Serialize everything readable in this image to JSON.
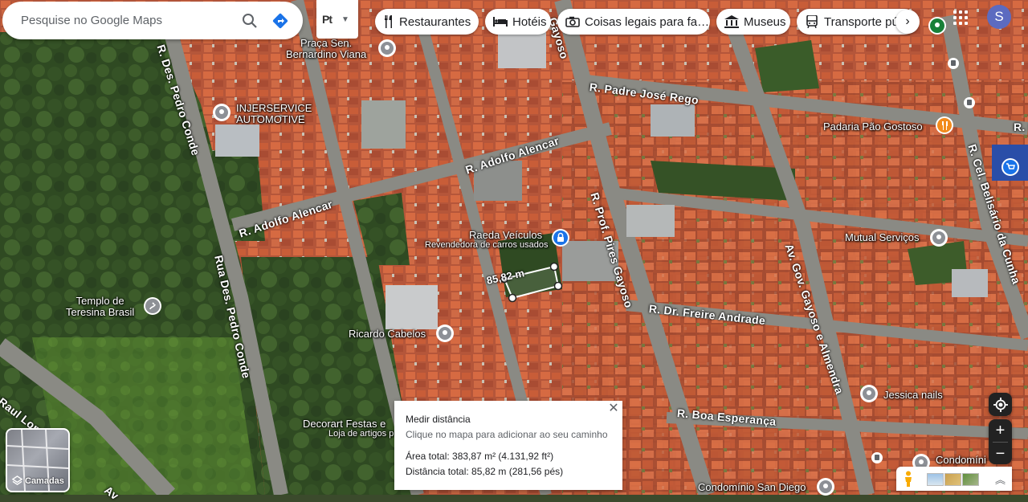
{
  "search": {
    "placeholder": "Pesquise no Google Maps",
    "search_icon": "search-icon",
    "directions_icon": "directions-icon"
  },
  "route_button": {
    "label": "Pt",
    "icon": "route-icon"
  },
  "chips": [
    {
      "label": "Restaurantes",
      "icon": "fork-knife-icon"
    },
    {
      "label": "Hotéis",
      "icon": "bed-icon"
    },
    {
      "label": "Coisas legais para fa…",
      "icon": "camera-icon"
    },
    {
      "label": "Museus",
      "icon": "museum-icon"
    },
    {
      "label": "Transporte pú",
      "icon": "transit-icon"
    }
  ],
  "chip_more": "›",
  "avatar": {
    "initial": "S",
    "color": "#5c6bc0"
  },
  "places": {
    "praca": "Praça Sen.\nBernardino Viana",
    "injerservice": "INJERSERVICE\nAUTOMOTIVE",
    "padaria": "Padaria Pão Gostoso",
    "raeda": "Raeda Veículos",
    "raeda_sub": "Revendedora de carros usados",
    "templo": "Templo de\nTeresina Brasil",
    "ricardo": "Ricardo Cabelos",
    "decorart": "Decorart Festas e",
    "decorart_sub": "Loja de artigos p",
    "mutual": "Mutual Serviços",
    "jessica": "Jessica nails",
    "condominio1": "Condomíni",
    "condominio2": "Condomínio San Diego"
  },
  "streets": {
    "padre_jose": "R. Padre José Rego",
    "adolfo1": "R. Adolfo Alencar",
    "adolfo2": "R. Adolfo Alencar",
    "pedro_conde1": "R. Des. Pedro Conde",
    "pedro_conde2": "Rua Des. Pedro Conde",
    "pires_gayoso": "R. Prof. Pires Gayoso",
    "gayoso_top": "Gayoso",
    "freire": "R. Dr. Freire Andrade",
    "gov_gayoso": "Av. Gov. Gayoso e Almendra",
    "belisario": "R. Cel. Belisário da Cunha",
    "boa_esperanca": "R. Boa Esperança",
    "raul_lopes": "Raul Lope",
    "av_bottom": "Av",
    "r_p": "R. P"
  },
  "measure_overlay": {
    "segment_label": "85,82 m",
    "title": "Medir distância",
    "hint": "Clique no mapa para adicionar ao seu caminho",
    "area": "Área total: 383,87 m² (4.131,92 ft²)",
    "distance": "Distância total: 85,82 m (281,56 pés)"
  },
  "layers": {
    "label": "Camadas",
    "icon": "layers-icon"
  },
  "controls": {
    "zoom_in": "+",
    "zoom_out": "−",
    "locate_icon": "my-location-icon"
  },
  "colors": {
    "accent": "#1a73e8",
    "pin_gray": "#70757a",
    "food_orange": "#f28b1d",
    "shop_blue": "#1a73e8"
  }
}
